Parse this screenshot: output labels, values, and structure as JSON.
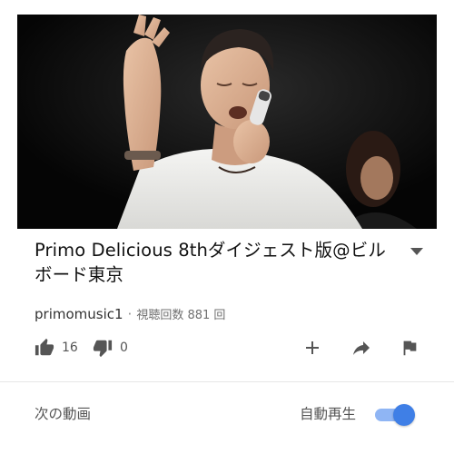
{
  "video": {
    "title": "Primo Delicious 8thダイジェスト版@ビルボード東京"
  },
  "channel": {
    "name": "primomusic1",
    "separator": "·",
    "views": "視聴回数 881 回"
  },
  "actions": {
    "like_count": "16",
    "dislike_count": "0",
    "icons": [
      "thumb-up-icon",
      "thumb-down-icon",
      "add-icon",
      "share-icon",
      "flag-icon"
    ]
  },
  "up_next": {
    "label": "次の動画",
    "autoplay_label": "自動再生",
    "autoplay_on": true
  },
  "colors": {
    "accent": "#3f7fe6",
    "accent_track": "#8fb5f4",
    "icon": "#555555",
    "text": "#111111"
  }
}
